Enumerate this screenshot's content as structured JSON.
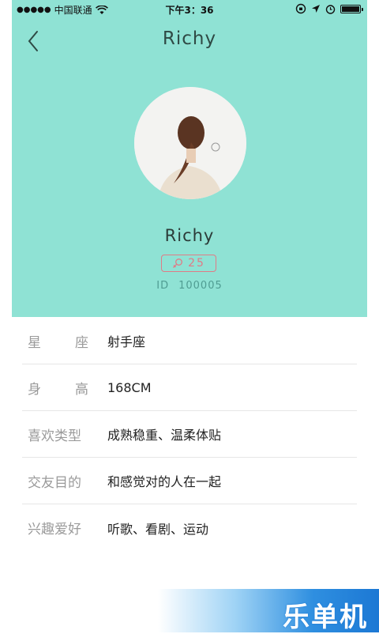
{
  "status_bar": {
    "signal": "●●●●●",
    "carrier": "中国联通",
    "time": "下午3：36"
  },
  "nav": {
    "title": "Richy"
  },
  "profile": {
    "name": "Richy",
    "age": "25",
    "id_label": "ID",
    "id_value": "100005"
  },
  "info_rows": [
    {
      "label_a": "星",
      "label_b": "座",
      "value": "射手座"
    },
    {
      "label_a": "身",
      "label_b": "高",
      "value": "168CM"
    },
    {
      "label": "喜欢类型",
      "value": "成熟稳重、温柔体贴"
    },
    {
      "label": "交友目的",
      "value": "和感觉对的人在一起"
    },
    {
      "label": "兴趣爱好",
      "value": "听歌、看剧、运动"
    }
  ],
  "watermark": "乐单机",
  "colors": {
    "header_bg": "#8fe2d4",
    "badge": "#e07b86",
    "id_text": "#4f9c92"
  },
  "battery_level": 1.0
}
